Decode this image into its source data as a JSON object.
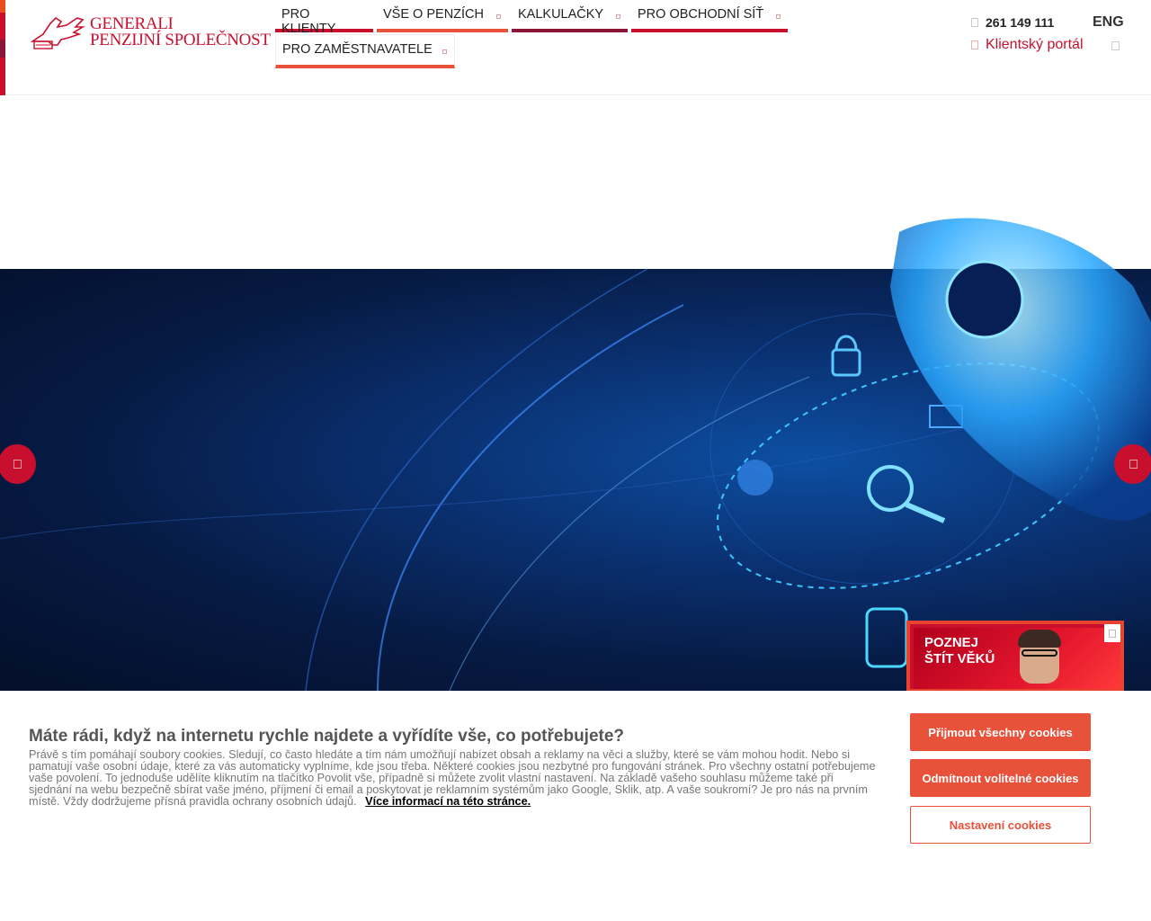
{
  "brand": {
    "line1": "GENERALI",
    "line2": "PENZIJNÍ SPOLEČNOST"
  },
  "nav": {
    "pro_klienty": "PRO KLIENTY",
    "vse_o_penzich": "VŠE O PENZÍCH",
    "kalkulacky": "KALKULAČKY",
    "pro_obchodni_sit": "PRO OBCHODNÍ SÍŤ",
    "pro_zamestnavatele": "PRO ZAMĚSTNAVATELE"
  },
  "contact": {
    "phone": "261 149 111",
    "language": "ENG",
    "portal": "Klientský portál"
  },
  "promo": {
    "line1": "POZNEJ",
    "line2": "ŠTÍT VĚKŮ"
  },
  "cookie": {
    "title": "Máte rádi, když na internetu rychle najdete a vyřídíte vše, co potřebujete?",
    "body": "Právě s tím pomáhají soubory cookies. Sledují, co často hledáte a tím nám umožňují nabízet obsah a reklamy na věci a služby, které se vám mohou hodit. Nebo si pamatují vaše osobní údaje, které za vás automaticky vyplníme, kde jsou třeba. Některé cookies jsou nezbytné pro fungování stránek. Pro všechny ostatní potřebujeme vaše povolení. To jednoduše udělíte kliknutím na tlačítko Povolit vše, případně si můžete zvolit vlastní nastavení. Na základě vašeho souhlasu můžeme také při sjednání na webu bezpečně sbírat vaše jméno, příjmení či email a poskytovat je reklamním systémům jako Google, Sklik, atp. A vaše soukromí? Je pro nás na prvním místě. Vždy dodržujeme přísná pravidla ochrany osobních údajů.",
    "link": "Více informací na této stránce.",
    "accept_all": "Přijmout všechny cookies",
    "reject_optional": "Odmítnout volitelné cookies",
    "settings": "Nastavení cookies"
  },
  "colors": {
    "brand_red": "#c8102e",
    "accent_orange": "#e8513a",
    "hero_blue": "#0a2f6e"
  },
  "icons": {
    "phone": "phone-icon",
    "portal": "user-icon",
    "search": "search-icon",
    "prev": "arrow-left-icon",
    "next": "arrow-right-icon",
    "close": "close-icon"
  }
}
